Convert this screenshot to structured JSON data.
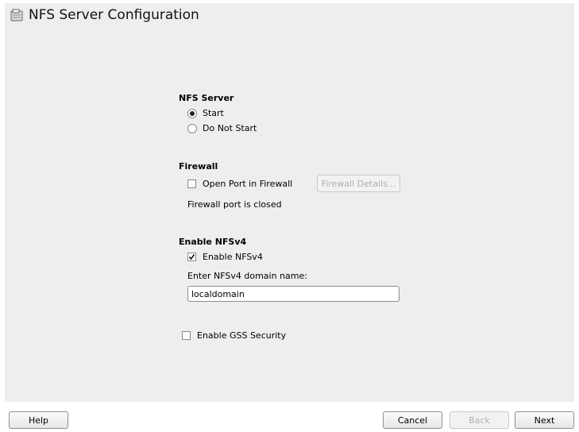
{
  "window": {
    "title": "NFS Server Configuration",
    "icon": "nfs-server-icon"
  },
  "nfs_server": {
    "heading": "NFS Server",
    "options": [
      {
        "label": "Start",
        "selected": true
      },
      {
        "label": "Do Not Start",
        "selected": false
      }
    ]
  },
  "firewall": {
    "heading": "Firewall",
    "open_port_label": "Open Port in Firewall",
    "open_port_checked": false,
    "details_button": "Firewall Details...",
    "status": "Firewall port is closed"
  },
  "nfsv4": {
    "heading": "Enable NFSv4",
    "enable_label": "Enable NFSv4",
    "enable_checked": true,
    "domain_label": "Enter NFSv4 domain name:",
    "domain_value": "localdomain"
  },
  "gss": {
    "label": "Enable GSS Security",
    "checked": false
  },
  "buttons": {
    "help": "Help",
    "cancel": "Cancel",
    "back": "Back",
    "next": "Next"
  }
}
